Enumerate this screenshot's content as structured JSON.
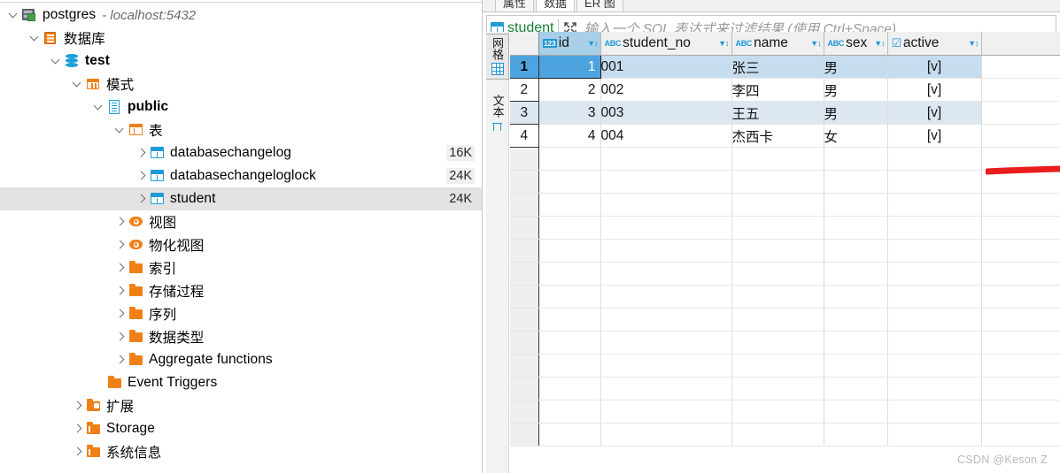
{
  "navigator": {
    "tree": [
      {
        "label": "postgres",
        "sub": " - localhost:5432",
        "icon": "server-icon",
        "indent": 0,
        "twisty": "open",
        "bold": false,
        "size": ""
      },
      {
        "label": "数据库",
        "sub": "",
        "icon": "database-folder-icon",
        "indent": 1,
        "twisty": "open",
        "bold": false,
        "size": ""
      },
      {
        "label": "test",
        "sub": "",
        "icon": "database-icon",
        "indent": 2,
        "twisty": "open",
        "bold": true,
        "size": ""
      },
      {
        "label": "模式",
        "sub": "",
        "icon": "schemas-icon",
        "indent": 3,
        "twisty": "open",
        "bold": false,
        "size": ""
      },
      {
        "label": "public",
        "sub": "",
        "icon": "schema-icon",
        "indent": 4,
        "twisty": "open",
        "bold": true,
        "size": ""
      },
      {
        "label": "表",
        "sub": "",
        "icon": "tables-folder-icon",
        "indent": 5,
        "twisty": "open",
        "bold": false,
        "size": ""
      },
      {
        "label": "databasechangelog",
        "sub": "",
        "icon": "table-icon",
        "indent": 6,
        "twisty": "closed",
        "bold": false,
        "size": "16K"
      },
      {
        "label": "databasechangeloglock",
        "sub": "",
        "icon": "table-icon",
        "indent": 6,
        "twisty": "closed",
        "bold": false,
        "size": "24K"
      },
      {
        "label": "student",
        "sub": "",
        "icon": "table-icon",
        "indent": 6,
        "twisty": "closed",
        "bold": false,
        "size": "24K",
        "selected": true
      },
      {
        "label": "视图",
        "sub": "",
        "icon": "view-icon",
        "indent": 5,
        "twisty": "closed",
        "bold": false,
        "size": ""
      },
      {
        "label": "物化视图",
        "sub": "",
        "icon": "view-icon",
        "indent": 5,
        "twisty": "closed",
        "bold": false,
        "size": ""
      },
      {
        "label": "索引",
        "sub": "",
        "icon": "folder-icon",
        "indent": 5,
        "twisty": "closed",
        "bold": false,
        "size": ""
      },
      {
        "label": "存储过程",
        "sub": "",
        "icon": "folder-icon",
        "indent": 5,
        "twisty": "closed",
        "bold": false,
        "size": ""
      },
      {
        "label": "序列",
        "sub": "",
        "icon": "folder-icon",
        "indent": 5,
        "twisty": "closed",
        "bold": false,
        "size": ""
      },
      {
        "label": "数据类型",
        "sub": "",
        "icon": "folder-icon",
        "indent": 5,
        "twisty": "closed",
        "bold": false,
        "size": ""
      },
      {
        "label": "Aggregate functions",
        "sub": "",
        "icon": "folder-icon",
        "indent": 5,
        "twisty": "closed",
        "bold": false,
        "size": ""
      },
      {
        "label": "Event Triggers",
        "sub": "",
        "icon": "folder-icon",
        "indent": 4,
        "twisty": "none",
        "bold": false,
        "size": ""
      },
      {
        "label": "扩展",
        "sub": "",
        "icon": "folder-extension-icon",
        "indent": 3,
        "twisty": "closed",
        "bold": false,
        "size": ""
      },
      {
        "label": "Storage",
        "sub": "",
        "icon": "folder-info-icon",
        "indent": 3,
        "twisty": "closed",
        "bold": false,
        "size": ""
      },
      {
        "label": "系统信息",
        "sub": "",
        "icon": "folder-info-icon",
        "indent": 3,
        "twisty": "closed",
        "bold": false,
        "size": ""
      }
    ]
  },
  "editor": {
    "tabs": [
      {
        "label": "属性",
        "active": false
      },
      {
        "label": "数据",
        "active": true
      },
      {
        "label": "ER 图",
        "active": false
      }
    ],
    "filter_bar": {
      "table_name": "student",
      "placeholder": "输入一个 SQL 表达式来过滤结果 (使用 Ctrl+Space)",
      "expand_icon": "expand-arrows-icon"
    },
    "presentation_toolbar": [
      {
        "label": "网格",
        "icon": "grid-icon",
        "active": true
      },
      {
        "label": "文本",
        "icon": "text-icon",
        "active": false
      }
    ]
  },
  "grid": {
    "columns": [
      {
        "name": "id",
        "type_icon": "123",
        "type": "number",
        "pk": true
      },
      {
        "name": "student_no",
        "type_icon": "ABC",
        "type": "string",
        "pk": false
      },
      {
        "name": "name",
        "type_icon": "ABC",
        "type": "string",
        "pk": false
      },
      {
        "name": "sex",
        "type_icon": "ABC",
        "type": "string",
        "pk": false
      },
      {
        "name": "active",
        "type_icon": "☑",
        "type": "boolean",
        "pk": false
      }
    ],
    "sort_icon": "filter-sort-icon",
    "rows": [
      {
        "n": "1",
        "id": "1",
        "student_no": "001",
        "name": "张三",
        "sex": "男",
        "active": "[v]"
      },
      {
        "n": "2",
        "id": "2",
        "student_no": "002",
        "name": "李四",
        "sex": "男",
        "active": "[v]"
      },
      {
        "n": "3",
        "id": "3",
        "student_no": "003",
        "name": "王五",
        "sex": "男",
        "active": "[v]"
      },
      {
        "n": "4",
        "id": "4",
        "student_no": "004",
        "name": "杰西卡",
        "sex": "女",
        "active": "[v]"
      }
    ],
    "empty_row_count": 13,
    "selected_row": 1,
    "cursor_cell": "id"
  },
  "annotation": {
    "stroke_color": "#e81d1d"
  },
  "watermark": "CSDN @Keson Z",
  "colors": {
    "accent": "#2196d6",
    "pk_header": "#a8cfe8",
    "selected_row": "#c6dcef",
    "alt_row": "#dce7f2",
    "folder_orange": "#f08016",
    "table_green": "#1a7f37"
  }
}
